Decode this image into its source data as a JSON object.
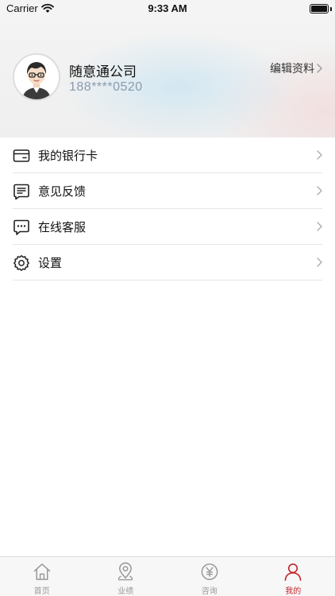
{
  "status_bar": {
    "carrier": "Carrier",
    "time": "9:33 AM"
  },
  "profile": {
    "name": "随意通公司",
    "phone": "188****0520",
    "edit_label": "编辑资料"
  },
  "menu": {
    "items": [
      {
        "label": "我的银行卡",
        "icon": "bank-card-icon"
      },
      {
        "label": "意见反馈",
        "icon": "feedback-icon"
      },
      {
        "label": "在线客服",
        "icon": "chat-icon"
      },
      {
        "label": "设置",
        "icon": "gear-icon"
      }
    ]
  },
  "tab_bar": {
    "tabs": [
      {
        "label": "首页",
        "icon": "home-icon",
        "active": false
      },
      {
        "label": "业绩",
        "icon": "location-pin-icon",
        "active": false
      },
      {
        "label": "咨询",
        "icon": "yen-coin-icon",
        "active": false
      },
      {
        "label": "我的",
        "icon": "person-icon",
        "active": true
      }
    ]
  },
  "colors": {
    "accent": "#c1272d",
    "tab_inactive": "#999999",
    "phone_text": "#8a9bb0"
  }
}
